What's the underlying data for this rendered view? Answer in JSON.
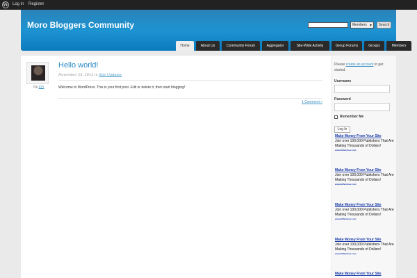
{
  "admin_bar": {
    "login": "Log in",
    "register": "Register"
  },
  "header": {
    "site_title": "Moro Bloggers Community",
    "search_select": "Members",
    "search_button": "Search",
    "tabs": [
      "Home",
      "About Us",
      "Community Forum",
      "Aggregator",
      "Site-Wide Activity",
      "Group Forums",
      "Groups",
      "Members"
    ]
  },
  "post": {
    "title": "Hello world!",
    "date": "November 25, 2012",
    "in": "in",
    "category": "Site Updates",
    "body": "Welcome to WordPress. This is your first post. Edit or delete it, then start blogging!",
    "comments": "1 Comment »",
    "by": "by",
    "author": "jan"
  },
  "sidebar": {
    "welcome_before": "Please",
    "welcome_link": "create an account",
    "welcome_after": "to get started.",
    "username_label": "Username",
    "password_label": "Password",
    "remember_label": "Remember Me",
    "login_button": "Log In",
    "ads": [
      {
        "title": "Make Money From Your Site",
        "text": "Join over 100,000 Publishers That Are Making Thousands of Dollars!",
        "url": "www.BidVertiser.com"
      },
      {
        "title": "Make Money From Your Site",
        "text": "Join over 100,000 Publishers That Are Making Thousands of Dollars!",
        "url": "www.BidVertiser.com"
      },
      {
        "title": "Make Money From Your Site",
        "text": "Join over 100,000 Publishers That Are Making Thousands of Dollars!",
        "url": "www.BidVertiser.com"
      },
      {
        "title": "Make Money From Your Site",
        "text": "Join over 100,000 Publishers That Are Making Thousands of Dollars!",
        "url": "www.BidVertiser.com"
      },
      {
        "title": "Make Money From Your Site",
        "text": "",
        "url": ""
      }
    ]
  }
}
